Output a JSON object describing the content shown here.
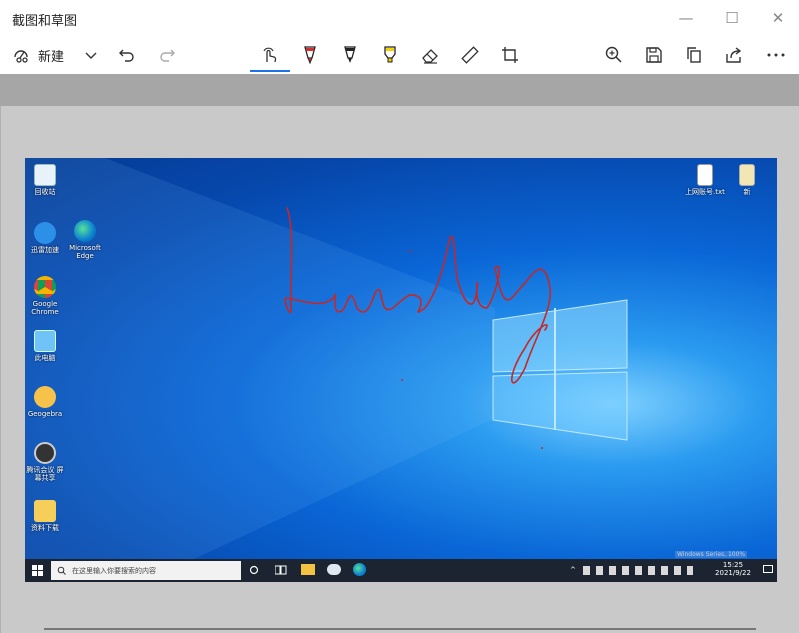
{
  "app": {
    "title": "截图和草图"
  },
  "window_controls": {
    "minimize": "—",
    "maximize": "☐",
    "close": "✕"
  },
  "toolbar": {
    "new_label": "新建",
    "icons": [
      "new-snip-icon",
      "chevron-down-icon",
      "undo-icon",
      "redo-icon",
      "touch-writing-icon",
      "ballpoint-pen-icon",
      "pencil-icon",
      "highlighter-icon",
      "eraser-icon",
      "ruler-icon",
      "crop-icon",
      "zoom-icon",
      "save-icon",
      "copy-icon",
      "share-icon",
      "more-icon"
    ],
    "pen_color": "#d32f2f",
    "highlighter_color": "#f5d300",
    "active_indicator_color": "#1a73e8"
  },
  "screenshot": {
    "ink_text": "Lucky",
    "ink_color": "#c62828",
    "desktop_icons": [
      {
        "label": "回收站"
      },
      {
        "label": "迅雷加速"
      },
      {
        "label": "Microsoft Edge"
      },
      {
        "label": "Google Chrome"
      },
      {
        "label": "此电脑"
      },
      {
        "label": "Geogebra"
      },
      {
        "label": "腾讯会议 屏幕共享"
      },
      {
        "label": "资料下载"
      }
    ],
    "right_icons": [
      {
        "label": "上网账号.txt"
      },
      {
        "label": "新"
      }
    ],
    "taskbar": {
      "search_placeholder": "在这里输入你要搜索的内容",
      "time": "15:25",
      "date": "2021/9/22",
      "watermark": "Windows Series, 100%"
    }
  }
}
